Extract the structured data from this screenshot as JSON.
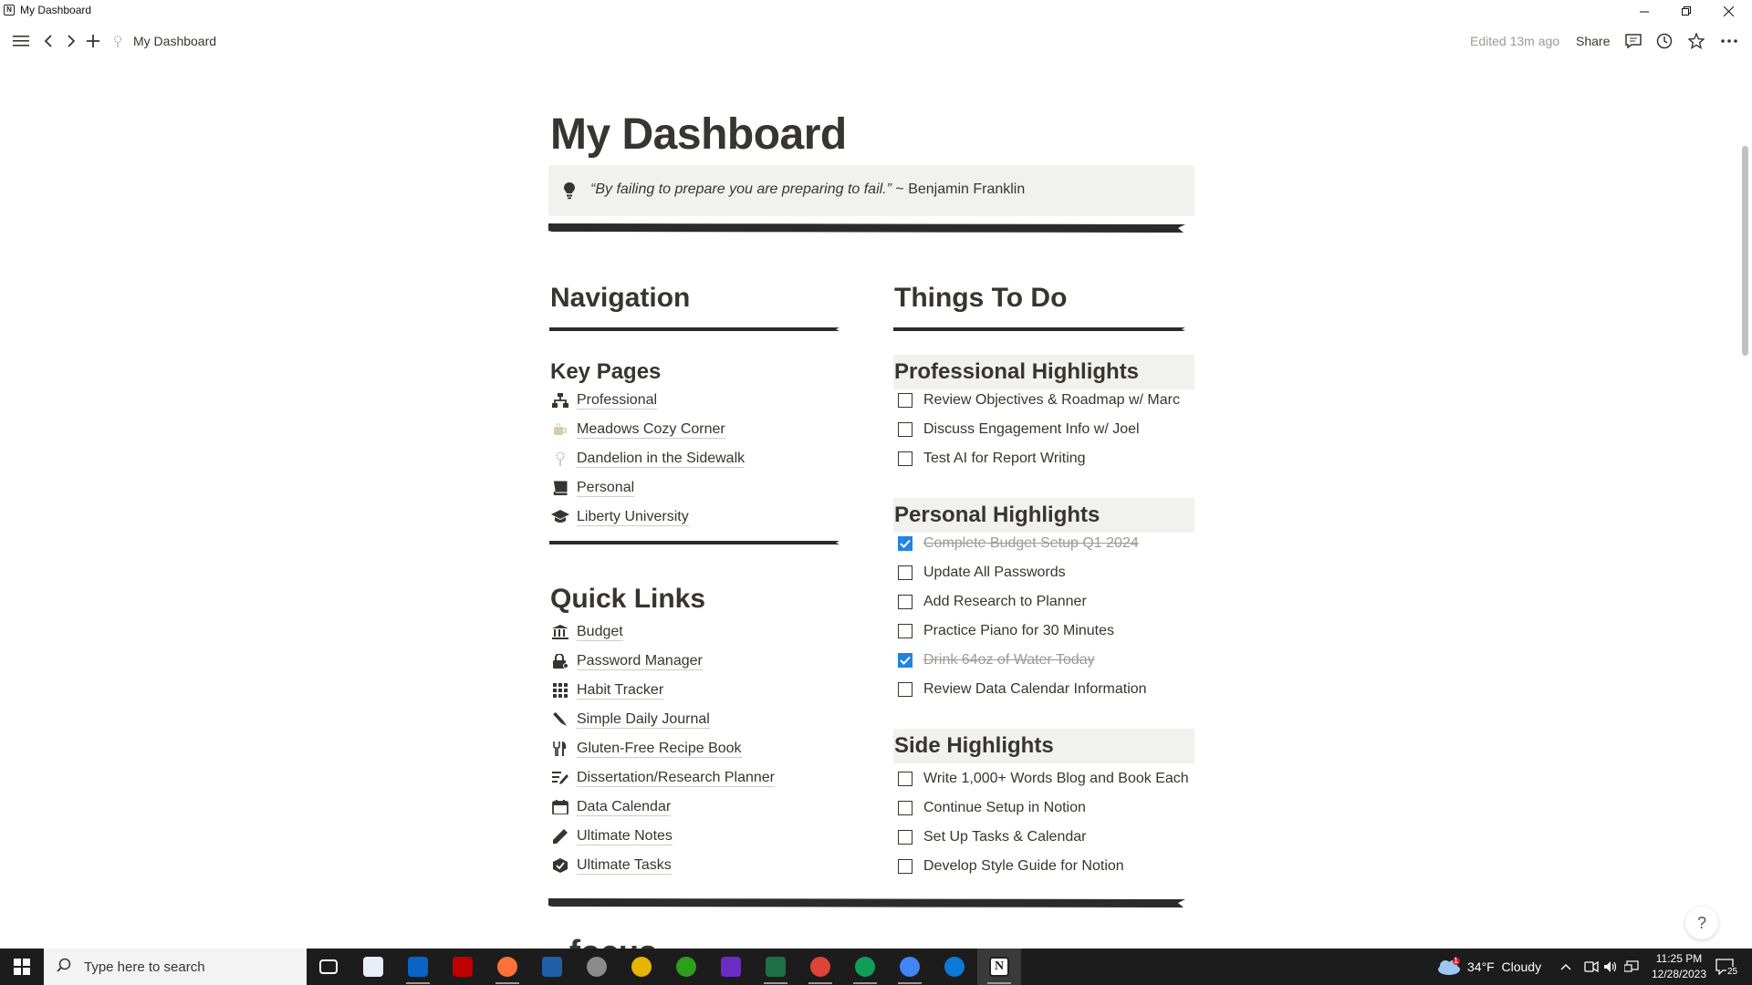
{
  "window": {
    "title": "My Dashboard"
  },
  "topbar": {
    "breadcrumb": "My Dashboard",
    "edited": "Edited 13m ago",
    "share": "Share"
  },
  "page": {
    "title": "My Dashboard",
    "quote": {
      "text": "“By failing to prepare you are preparing to fail.”",
      "author": " ~ Benjamin Franklin"
    },
    "navigation": {
      "heading": "Navigation",
      "key_pages": {
        "heading": "Key Pages",
        "items": [
          {
            "label": "Professional",
            "icon": "sitemap-icon"
          },
          {
            "label": "Meadows Cozy Corner",
            "icon": "mug-icon"
          },
          {
            "label": "Dandelion in the Sidewalk",
            "icon": "dandelion-icon"
          },
          {
            "label": "Personal",
            "icon": "book-icon"
          },
          {
            "label": "Liberty University",
            "icon": "graduation-cap-icon"
          }
        ]
      },
      "quick_links": {
        "heading": "Quick Links",
        "items": [
          {
            "label": "Budget",
            "icon": "bank-icon"
          },
          {
            "label": "Password Manager",
            "icon": "lock-icon"
          },
          {
            "label": "Habit Tracker",
            "icon": "grid-icon"
          },
          {
            "label": "Simple Daily Journal",
            "icon": "pen-icon"
          },
          {
            "label": "Gluten-Free Recipe Book",
            "icon": "utensils-icon"
          },
          {
            "label": "Dissertation/Research Planner",
            "icon": "list-pen-icon"
          },
          {
            "label": "Data Calendar",
            "icon": "calendar-icon"
          },
          {
            "label": "Ultimate Notes",
            "icon": "pencil-icon"
          },
          {
            "label": "Ultimate Tasks",
            "icon": "tasks-icon"
          }
        ]
      }
    },
    "todo": {
      "heading": "Things To Do",
      "groups": [
        {
          "heading": "Professional Highlights",
          "items": [
            {
              "text": "Review Objectives & Roadmap w/ Marc",
              "checked": false
            },
            {
              "text": "Discuss Engagement Info w/ Joel",
              "checked": false
            },
            {
              "text": "Test AI for Report Writing",
              "checked": false
            }
          ]
        },
        {
          "heading": "Personal Highlights",
          "items": [
            {
              "text": "Complete Budget Setup Q1 2024",
              "checked": true
            },
            {
              "text": "Update All Passwords",
              "checked": false
            },
            {
              "text": "Add Research to Planner",
              "checked": false
            },
            {
              "text": "Practice Piano for 30 Minutes",
              "checked": false
            },
            {
              "text": "Drink 64oz of Water Today",
              "checked": true
            },
            {
              "text": "Review Data Calendar Information",
              "checked": false
            }
          ]
        },
        {
          "heading": "Side Highlights",
          "items": [
            {
              "text": "Write 1,000+ Words Blog and Book Each",
              "checked": false
            },
            {
              "text": "Continue Setup in Notion",
              "checked": false
            },
            {
              "text": "Set Up Tasks & Calendar",
              "checked": false
            },
            {
              "text": "Develop Style Guide for Notion",
              "checked": false
            }
          ]
        }
      ]
    },
    "next_heading_partial": "focus",
    "help": "?"
  },
  "taskbar": {
    "search_placeholder": "Type here to search",
    "weather": "34°F  Cloudy",
    "time": "11:25 PM",
    "date": "12/28/2023",
    "notifications": "25",
    "weather_badge": "1",
    "apps": [
      {
        "name": "task-view",
        "color": "#1c1c1c"
      },
      {
        "name": "notepad",
        "color": "#e8eef8"
      },
      {
        "name": "outlook",
        "color": "#0a64c8"
      },
      {
        "name": "filezilla",
        "color": "#bf0000"
      },
      {
        "name": "firefox",
        "color": "#ff7139"
      },
      {
        "name": "app-blue-box",
        "color": "#1e5fa8"
      },
      {
        "name": "app-gray-circle",
        "color": "#8a8a8a"
      },
      {
        "name": "chrome",
        "color": "#e8b500"
      },
      {
        "name": "quickbooks",
        "color": "#2ca01c"
      },
      {
        "name": "app-purple",
        "color": "#6a2cc4"
      },
      {
        "name": "excel",
        "color": "#1d7044"
      },
      {
        "name": "chrome-2",
        "color": "#db4437"
      },
      {
        "name": "chrome-3",
        "color": "#0f9d58"
      },
      {
        "name": "chrome-4",
        "color": "#4285f4"
      },
      {
        "name": "edge",
        "color": "#0c7ad6"
      },
      {
        "name": "notion",
        "color": "#ffffff"
      }
    ]
  }
}
